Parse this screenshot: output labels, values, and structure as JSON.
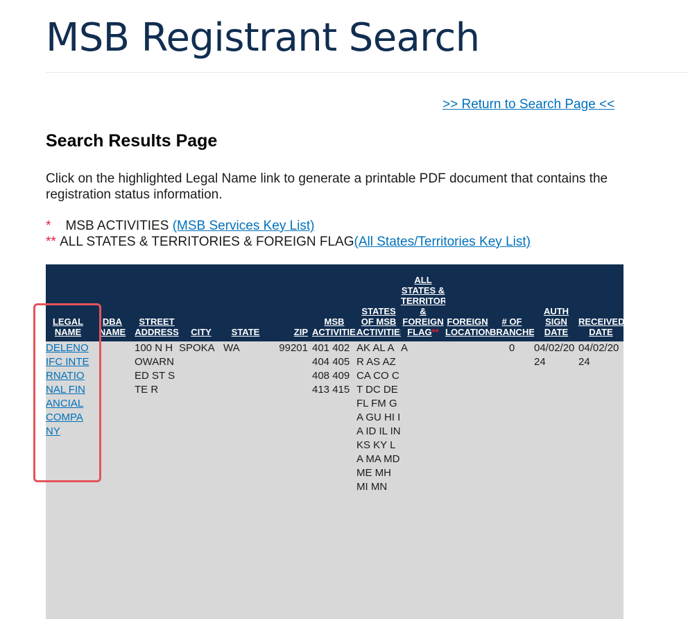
{
  "page": {
    "title": "MSB Registrant Search",
    "return_link": ">> Return to Search Page <<",
    "section_heading": "Search Results Page",
    "instructions": "Click on the highlighted Legal Name link to generate a printable PDF document that contains the registration status information.",
    "notes": [
      {
        "marker": "*",
        "text": "MSB ACTIVITIES",
        "link": "(MSB Services Key List)"
      },
      {
        "marker": "**",
        "text": "ALL STATES & TERRITORIES & FOREIGN FLAG",
        "link": "(All States/Territories Key List)"
      }
    ]
  },
  "table": {
    "headers": [
      "LEGAL NAME",
      "DBA NAME",
      "STREET ADDRESS",
      "CITY",
      "STATE",
      "ZIP",
      "MSB ACTIVITIES",
      "STATES OF MSB ACTIVITIES",
      "ALL STATES & TERRITORIES & FOREIGN FLAG",
      "FOREIGN LOCATION",
      "# OF BRANCHES",
      "AUTH SIGN DATE",
      "RECEIVED DATE"
    ],
    "header_marks": {
      "msb_activities": "*",
      "all_states_flag": "**"
    },
    "rows": [
      {
        "legal_name": "DELENO IFC INTERNATIONAL FINANCIAL COMPANY",
        "dba_name": "",
        "street_address": "100 N HOWARNED ST STE R",
        "city": "SPOKA",
        "state": "WA",
        "zip": "99201",
        "msb_activities": "401 402 404 405 408 409 413 415",
        "states_of_activities": "AK AL AR AS AZ CA CO CT DC DE FL FM GA GU HI IA ID IL IN KS KY LA MA MD ME MH MI MN",
        "all_states_flag": "A",
        "foreign_location": "",
        "branches": "0",
        "auth_sign_date": "04/02/2024",
        "received_date": "04/02/2024"
      }
    ]
  },
  "colors": {
    "title": "#112e51",
    "link": "#0071bc",
    "table_header_bg": "#112e51",
    "table_row_bg": "#d8d8d8",
    "required_marker": "#e31c3d",
    "highlight_box": "#e5545b"
  }
}
